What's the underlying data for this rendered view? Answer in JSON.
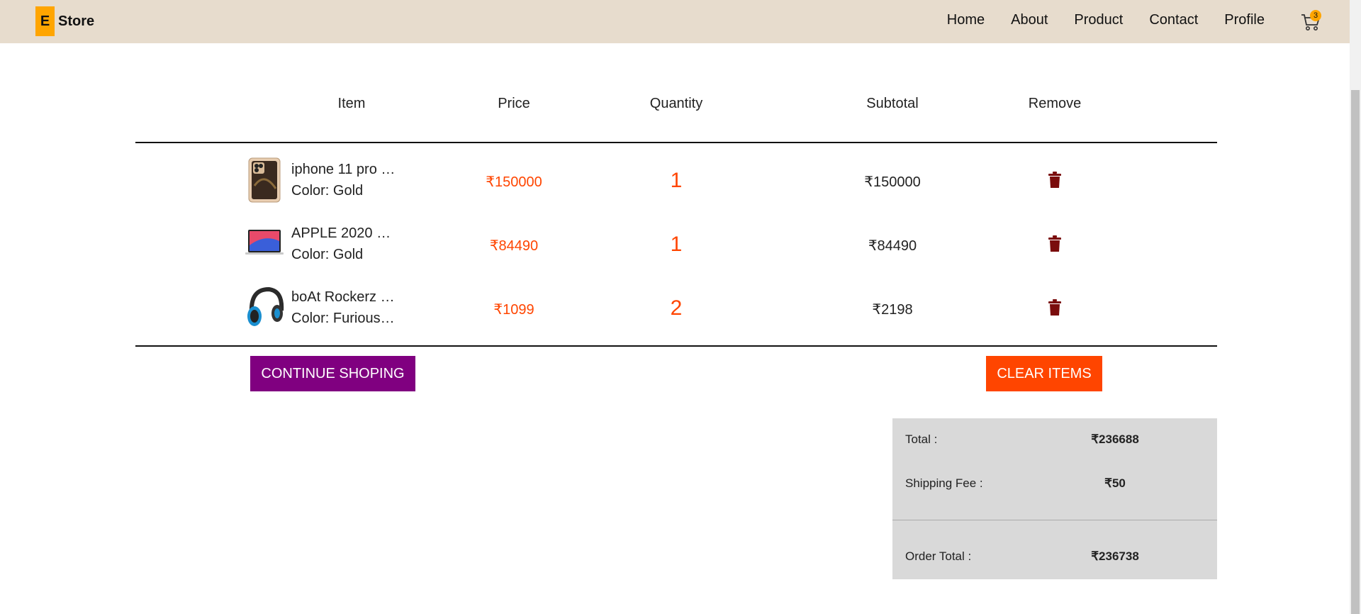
{
  "brand": {
    "badge": "E",
    "name": "Store"
  },
  "nav": {
    "items": [
      "Home",
      "About",
      "Product",
      "Contact",
      "Profile"
    ],
    "cart_count": "3"
  },
  "table": {
    "headers": [
      "Item",
      "Price",
      "Quantity",
      "Subtotal",
      "Remove"
    ],
    "rows": [
      {
        "name": "iphone 11 pro …",
        "color": "Color: Gold",
        "price": "₹150000",
        "quantity": "1",
        "subtotal": "₹150000",
        "thumb": "phone"
      },
      {
        "name": "APPLE 2020 …",
        "color": "Color: Gold",
        "price": "₹84490",
        "quantity": "1",
        "subtotal": "₹84490",
        "thumb": "laptop"
      },
      {
        "name": "boAt Rockerz …",
        "color": "Color: Furious…",
        "price": "₹1099",
        "quantity": "2",
        "subtotal": "₹2198",
        "thumb": "headphones"
      }
    ]
  },
  "buttons": {
    "continue": "CONTINUE SHOPING",
    "clear": "CLEAR ITEMS"
  },
  "summary": {
    "total_label": "Total :",
    "total_value": "₹236688",
    "shipping_label": "Shipping Fee :",
    "shipping_value": "₹50",
    "order_total_label": "Order Total :",
    "order_total_value": "₹236738"
  },
  "colors": {
    "header_bg": "#e7dccd",
    "brand_accent": "#ffa500",
    "price": "#ff4500",
    "continue_btn": "#800080",
    "clear_btn": "#ff4500",
    "trash": "#7a0c0c",
    "summary_bg": "#d9d9d9"
  },
  "icons": {
    "cart": "cart-icon",
    "remove": "trash-icon"
  }
}
